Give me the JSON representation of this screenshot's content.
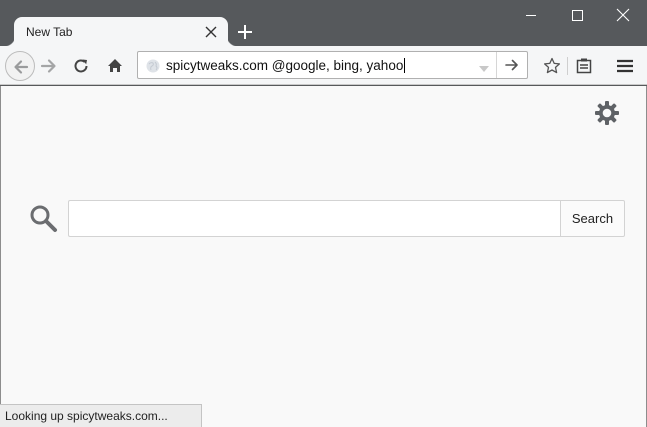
{
  "tab": {
    "title": "New Tab"
  },
  "urlbar": {
    "value": "spicytweaks.com @google, bing, yahoo"
  },
  "search": {
    "placeholder": "",
    "button_label": "Search"
  },
  "status": {
    "text": "Looking up spicytweaks.com..."
  },
  "icons": {
    "back": "arrow-left-icon",
    "forward": "arrow-right-icon",
    "reload": "reload-icon",
    "home": "home-icon",
    "site": "globe-icon",
    "history_dropdown": "triangle-down-icon",
    "go": "arrow-right-icon",
    "bookmark": "star-icon",
    "library": "library-icon",
    "menu": "hamburger-icon",
    "settings": "gear-icon",
    "search": "magnifier-icon",
    "new_tab": "plus-icon",
    "close_tab": "close-icon",
    "window_minimize": "minimize-icon",
    "window_maximize": "maximize-icon",
    "window_close": "close-icon"
  },
  "colors": {
    "titlebar": "#56595c",
    "toolbar": "#f5f6f7",
    "content_background": "#f9f9f9",
    "icon_gray": "#5f6266"
  }
}
